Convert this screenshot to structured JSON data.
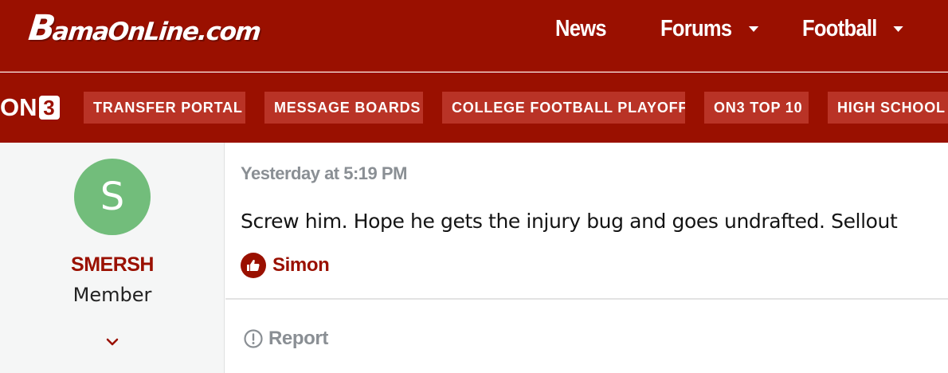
{
  "header": {
    "logo_text_B": "B",
    "logo_text_rest": "amaOnLine.com",
    "nav": [
      {
        "label": "News",
        "has_dropdown": false
      },
      {
        "label": "Forums",
        "has_dropdown": true
      },
      {
        "label": "Football",
        "has_dropdown": true
      }
    ]
  },
  "subnav": {
    "brand_text": "ON",
    "brand_digit": "3",
    "links": [
      "TRANSFER PORTAL",
      "MESSAGE BOARDS",
      "COLLEGE FOOTBALL PLAYOFF",
      "ON3 TOP 10",
      "HIGH SCHOOL F"
    ]
  },
  "post": {
    "user": {
      "avatar_letter": "S",
      "name": "SMERSH",
      "title": "Member"
    },
    "timestamp": "Yesterday at 5:19 PM",
    "body": "Screw him. Hope he gets the injury bug and goes undrafted. Sellout",
    "reaction": {
      "icon": "thumbs-up-icon",
      "user": "Simon"
    },
    "actions": {
      "report_label": "Report",
      "report_icon": "exclamation-circle-icon"
    }
  },
  "colors": {
    "brand_red": "#9a1000",
    "chip_red": "#b93326",
    "avatar_green": "#72bd7b",
    "muted_gray": "#8a8f94"
  }
}
